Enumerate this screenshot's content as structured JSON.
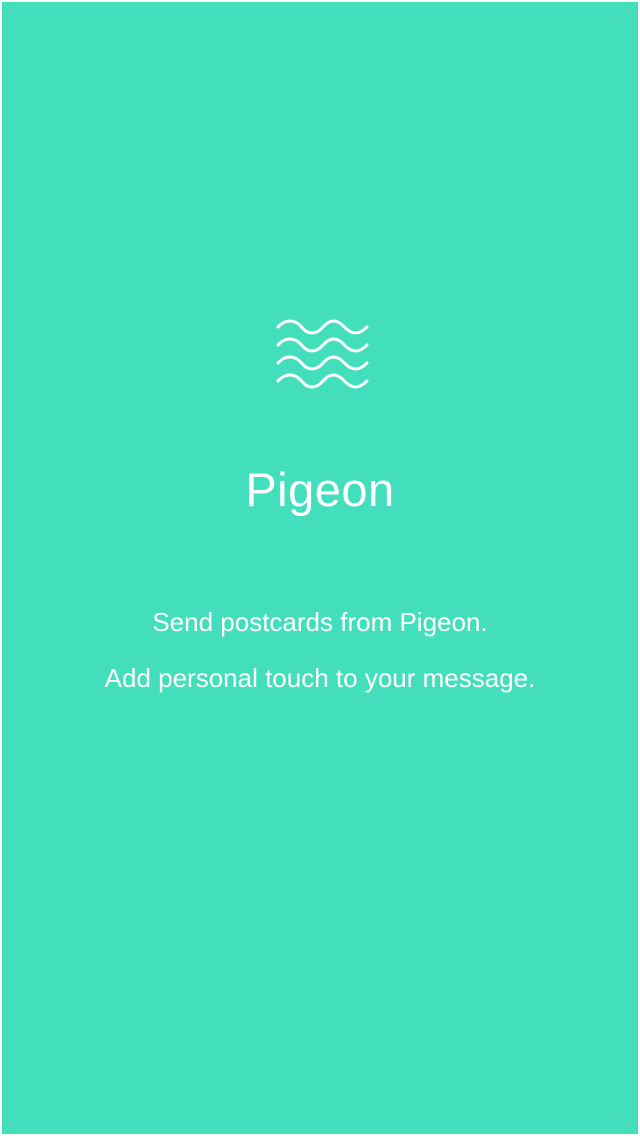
{
  "app": {
    "name": "Pigeon",
    "logo_icon": "waves-icon",
    "background_color": "#43dfbd",
    "text_color": "#ffffff"
  },
  "onboarding": {
    "line_1": "Send postcards from Pigeon.",
    "line_2": "Add personal touch to your message."
  }
}
